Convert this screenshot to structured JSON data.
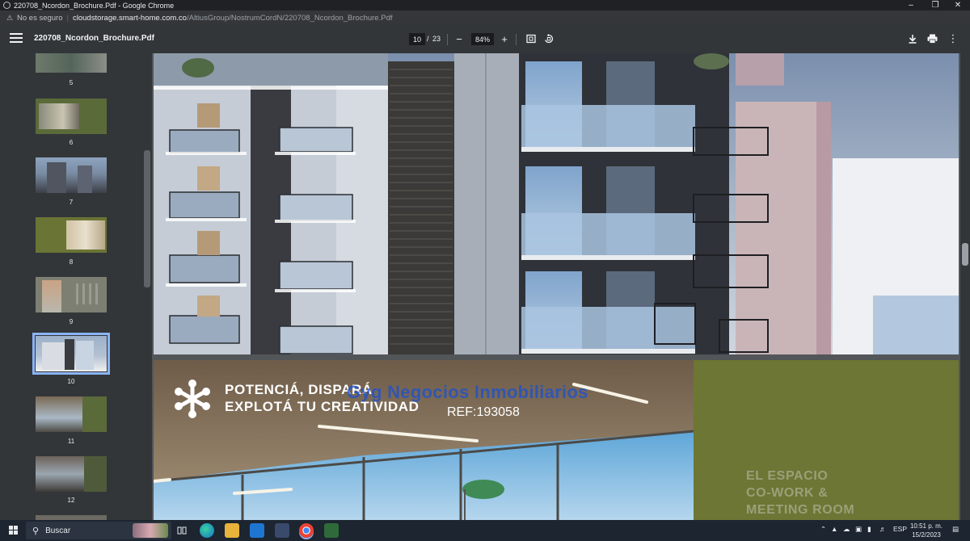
{
  "window": {
    "title": "220708_Ncordon_Brochure.Pdf - Google Chrome",
    "minimize_icon": "minimize-icon",
    "restore_icon": "restore-icon",
    "close_icon": "close-icon"
  },
  "address": {
    "security_text": "No es seguro",
    "host": "cloudstorage.smart-home.com.co",
    "path": "/AltiusGroup/NostrumCordN/220708_Ncordon_Brochure.Pdf"
  },
  "pdf_toolbar": {
    "doc_title": "220708_Ncordon_Brochure.Pdf",
    "current_page": "10",
    "page_separator": "/",
    "total_pages": "23",
    "zoom_out": "−",
    "zoom_level": "84%",
    "zoom_in": "+",
    "more": "⋮"
  },
  "sidebar": {
    "thumbnails": [
      {
        "label": "5"
      },
      {
        "label": "6"
      },
      {
        "label": "7"
      },
      {
        "label": "8"
      },
      {
        "label": "9"
      },
      {
        "label": "10"
      },
      {
        "label": "11"
      },
      {
        "label": "12"
      }
    ],
    "selected_page": 10
  },
  "document": {
    "watermark": "Gyg Negocios Inmobiliarios",
    "ref": "REF:193058",
    "slogan_line1": "POTENCIÁ, DISPARÁ",
    "slogan_line2": "EXPLOTÁ TU CREATIVIDAD",
    "cowork_line1": "EL ESPACIO",
    "cowork_line2": "CO-WORK &",
    "cowork_line3": "MEETING ROOM"
  },
  "taskbar": {
    "search_label": "Buscar",
    "language": "ESP",
    "time": "10:51 p. m.",
    "date": "15/2/2023"
  },
  "colors": {
    "selection": "#8ab4f8",
    "toolbar": "#323639",
    "green_panel": "#6d7634"
  }
}
